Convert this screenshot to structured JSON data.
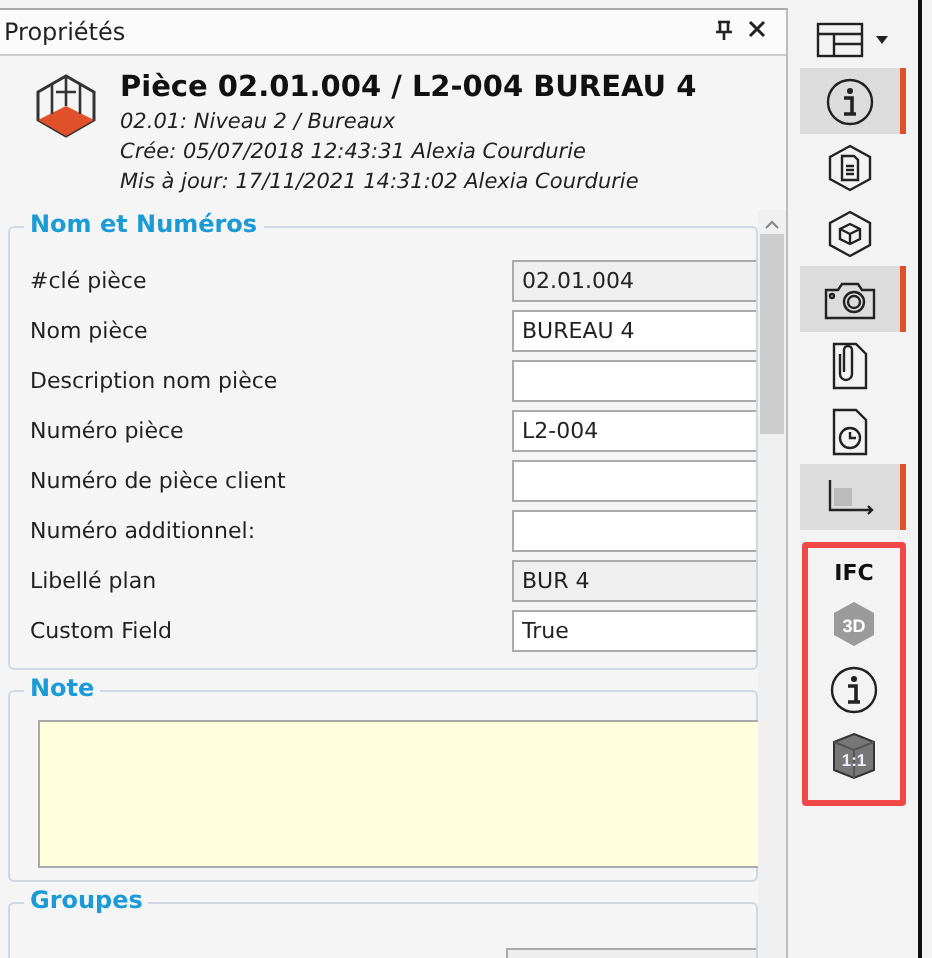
{
  "panel": {
    "title": "Propriétés"
  },
  "header": {
    "title": "Pièce 02.01.004 / L2-004 BUREAU 4",
    "lines": [
      "02.01: Niveau  2 / Bureaux",
      "Crée: 05/07/2018 12:43:31 Alexia Courdurie",
      "Mis à jour: 17/11/2021 14:31:02 Alexia Courdurie"
    ]
  },
  "sections": [
    {
      "kind": "fields",
      "title": "Nom et Numéros",
      "fields": [
        {
          "label": "#clé pièce",
          "value": "02.01.004",
          "readonly": true
        },
        {
          "label": "Nom pièce",
          "value": "BUREAU 4",
          "readonly": false
        },
        {
          "label": "Description nom pièce",
          "readonly": false
        },
        {
          "label": "Numéro pièce",
          "value": "L2-004",
          "readonly": false
        },
        {
          "label": "Numéro de pièce client",
          "readonly": false
        },
        {
          "label": "Numéro additionnel:",
          "readonly": false
        },
        {
          "label": "Libellé plan",
          "value": "BUR 4",
          "readonly": true
        },
        {
          "label": "Custom Field",
          "value": "True",
          "readonly": false
        }
      ]
    },
    {
      "kind": "note",
      "title": "Note"
    },
    {
      "kind": "group",
      "title": "Groupes"
    }
  ],
  "toolbar": {
    "items": [
      {
        "kind": "info",
        "selected": true
      },
      {
        "kind": "document",
        "selected": false
      },
      {
        "kind": "cube",
        "selected": false
      },
      {
        "kind": "camera",
        "selected": true
      },
      {
        "kind": "attachment",
        "selected": false
      },
      {
        "kind": "history",
        "selected": false
      },
      {
        "kind": "axes",
        "selected": true
      }
    ],
    "ifc": {
      "label": "IFC",
      "items": [
        {
          "kind": "threed"
        },
        {
          "kind": "info"
        },
        {
          "kind": "scale"
        }
      ],
      "scale_text": "1:1",
      "badge_text": "3D"
    }
  }
}
